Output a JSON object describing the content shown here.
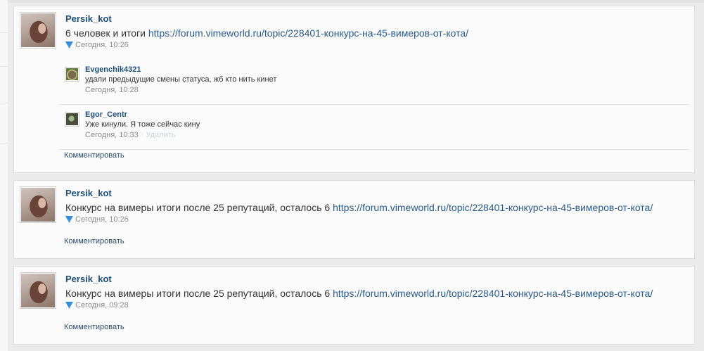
{
  "posts": [
    {
      "author": "Persik_kot",
      "text_prefix": "6 человек и итоги ",
      "link": "https://forum.vimeworld.ru/topic/228401-конкурс-на-45-вимеров-от-кота/",
      "time": "Сегодня, 10:26",
      "comments": [
        {
          "author": "Evgenchik4321",
          "text": "удали предыдущие смены статуса, жб кто нить кинет",
          "time": "Сегодня, 10:28",
          "delete": ""
        },
        {
          "author": "Egor_Centr",
          "text": "Уже кинули. Я тоже сейчас кину",
          "time": "Сегодня, 10:33",
          "delete": "· Удалить"
        }
      ],
      "comment_action": "Комментировать"
    },
    {
      "author": "Persik_kot",
      "text_prefix": "Конкурс на вимеры итоги после 25 репутаций, осталось 6 ",
      "link": "https://forum.vimeworld.ru/topic/228401-конкурс-на-45-вимеров-от-кота/",
      "time": "Сегодня, 10:26",
      "comment_action": "Комментировать"
    },
    {
      "author": "Persik_kot",
      "text_prefix": "Конкурс на вимеры итоги после 25 репутаций, осталось 6 ",
      "link": "https://forum.vimeworld.ru/topic/228401-конкурс-на-45-вимеров-от-кота/",
      "time": "Сегодня, 09:28",
      "comment_action": "Комментировать"
    }
  ]
}
